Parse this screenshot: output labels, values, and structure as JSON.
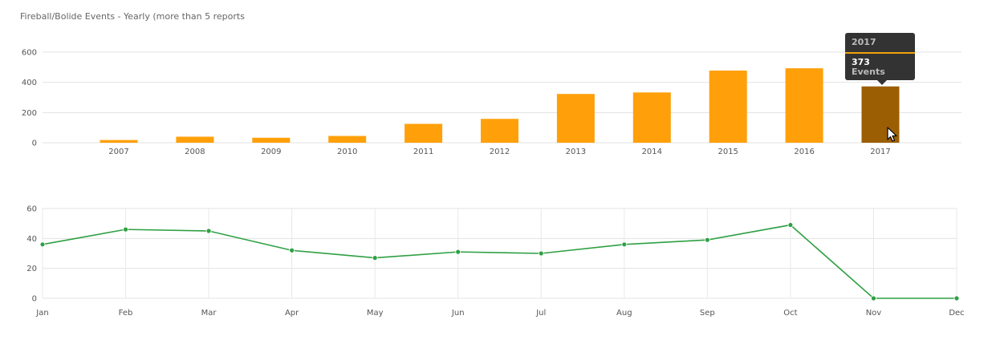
{
  "page": {
    "title": "Fireball/Bolide Events - Yearly (more than 5 reports"
  },
  "chart_data": [
    {
      "type": "bar",
      "title": "Fireball/Bolide Events - Yearly (more than 5 reports",
      "categories": [
        "2007",
        "2008",
        "2009",
        "2010",
        "2011",
        "2012",
        "2013",
        "2014",
        "2015",
        "2016",
        "2017"
      ],
      "values": [
        18,
        40,
        33,
        45,
        125,
        158,
        323,
        333,
        478,
        493,
        373
      ],
      "ylim": [
        0,
        600
      ],
      "yticks": [
        0,
        200,
        400,
        600
      ],
      "grid": true,
      "colors": {
        "bar": "#ffa00a",
        "highlight": "#9c5e03"
      },
      "highlighted": "2017",
      "tooltip": {
        "year": "2017",
        "value": "373",
        "label": "Events"
      }
    },
    {
      "type": "line",
      "categories": [
        "Jan",
        "Feb",
        "Mar",
        "Apr",
        "May",
        "Jun",
        "Jul",
        "Aug",
        "Sep",
        "Oct",
        "Nov",
        "Dec"
      ],
      "values": [
        36,
        46,
        45,
        32,
        27,
        31,
        30,
        36,
        39,
        49,
        0,
        0
      ],
      "ylim": [
        0,
        60
      ],
      "yticks": [
        0,
        20,
        40,
        60
      ],
      "grid": true,
      "colors": {
        "line": "#2ea043"
      }
    }
  ]
}
